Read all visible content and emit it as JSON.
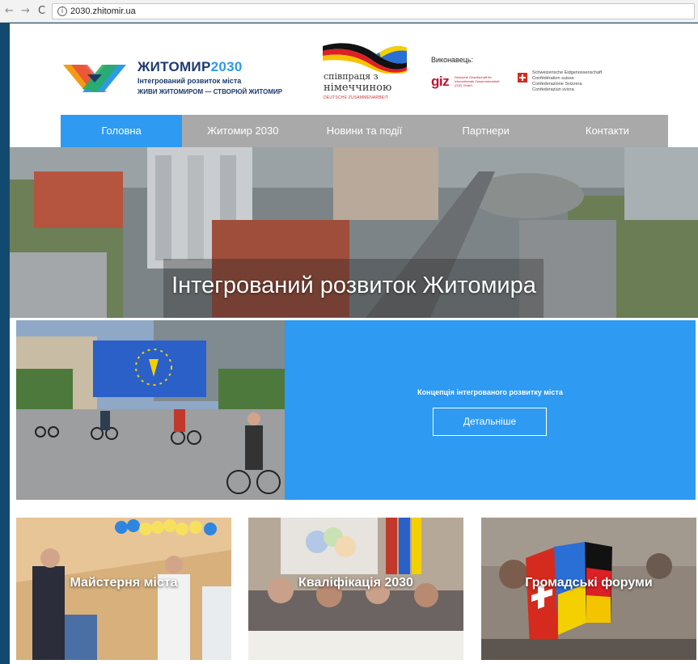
{
  "browser": {
    "back_icon": "←",
    "forward_icon": "→",
    "reload_icon": "C",
    "info_icon": "i",
    "url": "2030.zhitomir.ua"
  },
  "header": {
    "logo_title_main": "ЖИТОМИР",
    "logo_title_year": "2030",
    "logo_subtitle": "Інтегрований розвиток міста",
    "logo_tagline": "ЖИВИ ЖИТОМИРОМ — СТВОРЮЙ ЖИТОМИР",
    "partner_line1": "співпраця з",
    "partner_line2": "німеччиною",
    "partner_line3": "DEUTSCHE ZUSAMMENARBEIT",
    "executor_label": "Виконавець:",
    "giz_logo": "giz",
    "giz_text": "Deutsche Gesellschaft für Internationale Zusammenarbeit (GIZ) GmbH",
    "swiss_line1": "Schweizerische Eidgenossenschaft",
    "swiss_line2": "Confédération suisse",
    "swiss_line3": "Confederazione Svizzera",
    "swiss_line4": "Confederaziun svizra"
  },
  "nav": {
    "items": [
      "Головна",
      "Житомир 2030",
      "Новини та події",
      "Партнери",
      "Контакти"
    ],
    "active_index": 0
  },
  "hero": {
    "title": "Інтегрований розвиток Житомира"
  },
  "concept": {
    "text": "Концепція інтегрованого розвитку міста",
    "button": "Детальніше"
  },
  "cards": [
    {
      "title": "Майстерня міста"
    },
    {
      "title": "Кваліфікація 2030"
    },
    {
      "title": "Громадські форуми"
    }
  ],
  "colors": {
    "accent": "#2e9af2",
    "nav_bg": "#a9a9a9",
    "brand_dark": "#1d3a6e",
    "giz_red": "#c4122f"
  }
}
